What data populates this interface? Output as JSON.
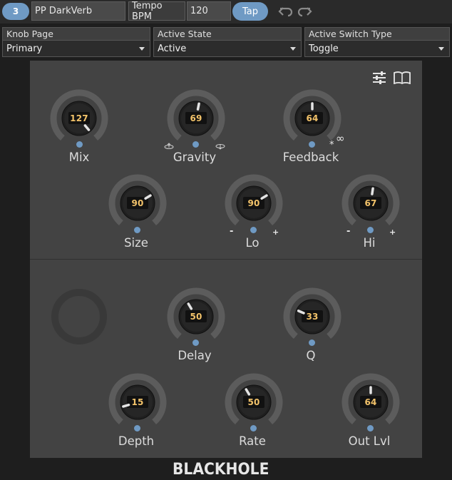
{
  "toolbar": {
    "preset_number": "3",
    "preset_name": "PP DarkVerb",
    "tempo_label": "Tempo BPM",
    "tempo_value": "120",
    "tap_label": "Tap"
  },
  "dropdowns": [
    {
      "label": "Knob Page",
      "value": "Primary"
    },
    {
      "label": "Active State",
      "value": "Active"
    },
    {
      "label": "Active Switch Type",
      "value": "Toggle"
    }
  ],
  "knobs": {
    "mix": {
      "label": "Mix",
      "value": "127",
      "level": 1.0
    },
    "gravity": {
      "label": "Gravity",
      "value": "69",
      "level": 0.54
    },
    "feedback": {
      "label": "Feedback",
      "value": "64",
      "level": 0.5,
      "extra_symbols": [
        "∞",
        "*"
      ]
    },
    "size": {
      "label": "Size",
      "value": "90",
      "level": 0.71,
      "minus": "-",
      "plus": ""
    },
    "lo": {
      "label": "Lo",
      "value": "90",
      "level": 0.71,
      "minus": "-",
      "plus": "+"
    },
    "hi": {
      "label": "Hi",
      "value": "67",
      "level": 0.53,
      "minus": "-",
      "plus": "+"
    },
    "delay": {
      "label": "Delay",
      "value": "50",
      "level": 0.39
    },
    "q": {
      "label": "Q",
      "value": "33",
      "level": 0.26
    },
    "depth": {
      "label": "Depth",
      "value": "15",
      "level": 0.12
    },
    "rate": {
      "label": "Rate",
      "value": "50",
      "level": 0.39
    },
    "outlvl": {
      "label": "Out Lvl",
      "value": "64",
      "level": 0.5
    }
  },
  "brand": "BLACKHOLE",
  "colors": {
    "accent": "#6f9ac4",
    "value_text": "#f3c36a",
    "panel": "#434343",
    "ring": "#5c5c5c"
  },
  "icons": {
    "undo": "undo-icon",
    "redo": "redo-icon",
    "settings": "sliders-icon",
    "manual": "book-icon",
    "gravity_left": "reverse-icon",
    "gravity_right": "forward-icon"
  }
}
